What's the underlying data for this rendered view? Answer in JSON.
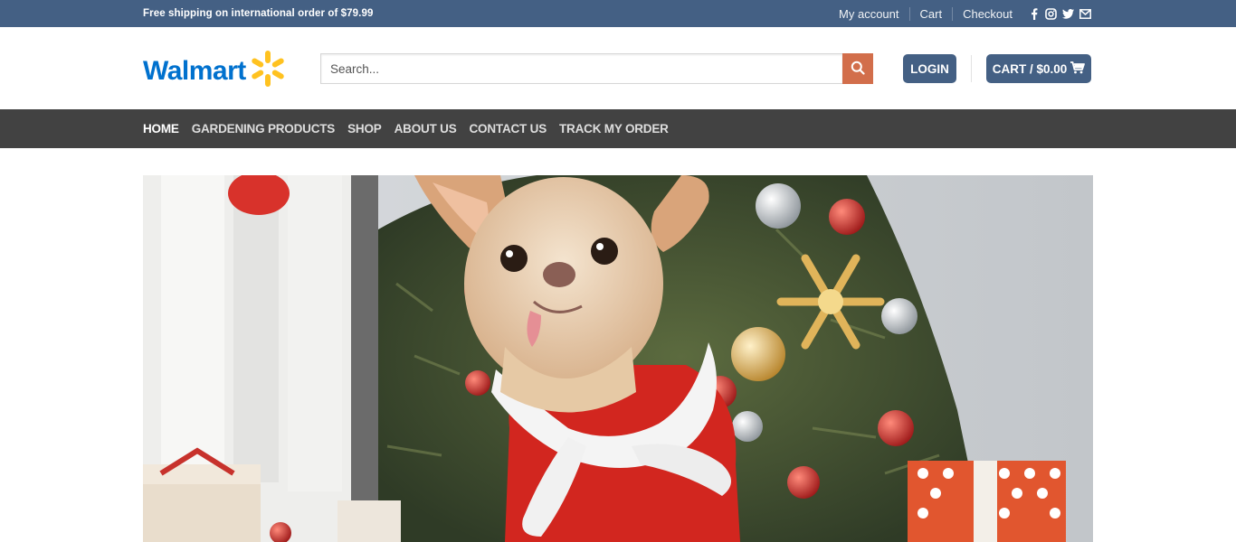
{
  "topbar": {
    "promo": "Free shipping on international order of $79.99",
    "links": [
      "My account",
      "Cart",
      "Checkout"
    ],
    "social_icons": [
      "facebook-icon",
      "instagram-icon",
      "twitter-icon",
      "email-icon"
    ]
  },
  "header": {
    "logo_text": "Walmart",
    "search_placeholder": "Search...",
    "login_label": "LOGIN",
    "cart_label": "CART / $0.00"
  },
  "nav": {
    "items": [
      "HOME",
      "GARDENING PRODUCTS",
      "SHOP",
      "ABOUT US",
      "CONTACT US",
      "TRACK MY ORDER"
    ]
  },
  "colors": {
    "topbar": "#446084",
    "nav": "#424242",
    "search_button": "#d26e4b",
    "brand_blue": "#0071ce",
    "brand_yellow": "#ffc220"
  }
}
